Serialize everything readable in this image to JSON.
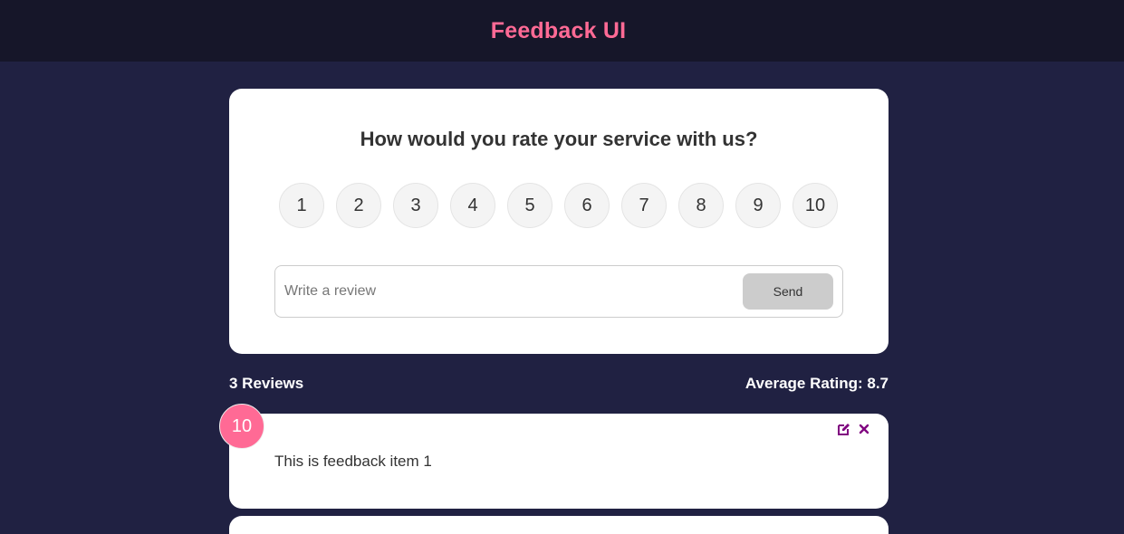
{
  "header": {
    "title": "Feedback UI"
  },
  "card": {
    "question": "How would you rate your service with us?",
    "ratings": [
      "1",
      "2",
      "3",
      "4",
      "5",
      "6",
      "7",
      "8",
      "9",
      "10"
    ],
    "review_placeholder": "Write a review",
    "send_label": "Send"
  },
  "stats": {
    "count_label": "3 Reviews",
    "average_label": "Average Rating: 8.7"
  },
  "feedback_items": [
    {
      "rating": "10",
      "text": "This is feedback item 1"
    }
  ],
  "colors": {
    "accent": "#ff6a95",
    "background": "#202142",
    "header": "#161629",
    "icon": "#800080"
  },
  "icons": {
    "edit": "edit-icon",
    "delete": "close-icon"
  }
}
